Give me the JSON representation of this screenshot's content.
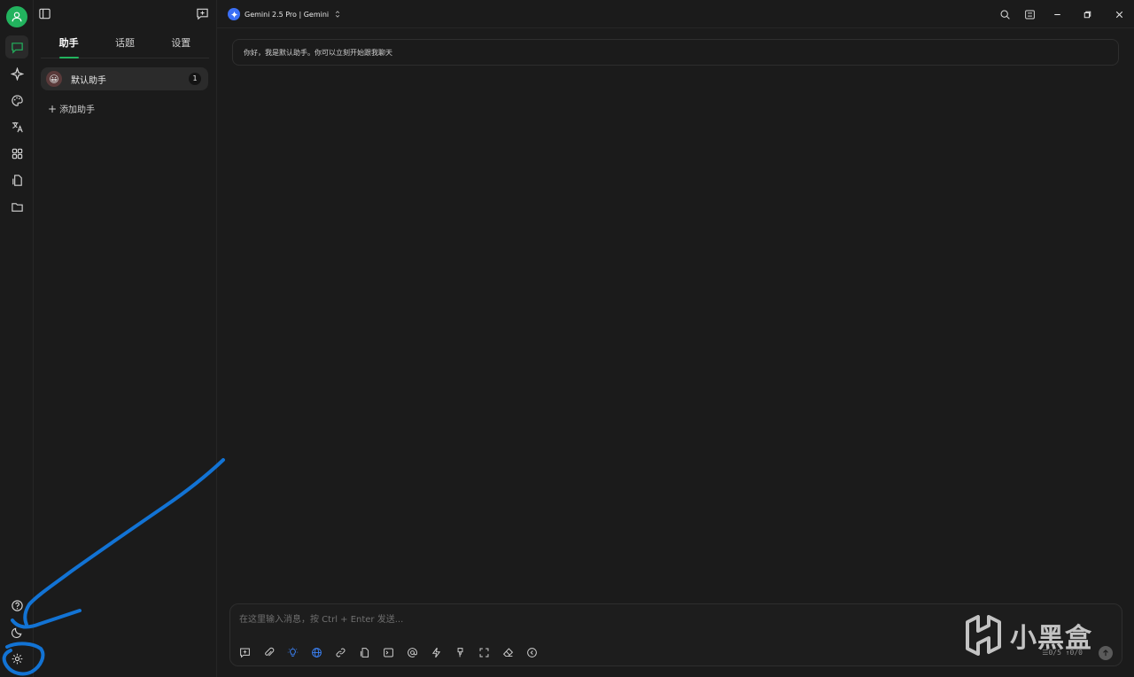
{
  "colors": {
    "accent": "#22b35e",
    "annotation": "#1273d4",
    "model_icon": "#3b6ff5"
  },
  "rail": {
    "items": [
      {
        "name": "chat-icon",
        "active": true
      },
      {
        "name": "sparkle-icon"
      },
      {
        "name": "palette-icon"
      },
      {
        "name": "translate-icon"
      },
      {
        "name": "apps-grid-icon"
      },
      {
        "name": "file-swap-icon"
      },
      {
        "name": "folder-icon"
      }
    ],
    "bottom": [
      {
        "name": "help-icon"
      },
      {
        "name": "moon-icon"
      },
      {
        "name": "settings-icon"
      }
    ]
  },
  "sidebar": {
    "tabs": [
      "助手",
      "话题",
      "设置"
    ],
    "active_tab": 0,
    "assistant": {
      "label": "默认助手",
      "count": "1",
      "emoji": "😀"
    },
    "add_label": "添加助手"
  },
  "topbar": {
    "model_label": "Gemini 2.5 Pro | Gemini"
  },
  "chat": {
    "greeting": "你好，我是默认助手。你可以立刻开始跟我聊天"
  },
  "composer": {
    "placeholder": "在这里输入消息，按 Ctrl + Enter 发送...",
    "counts": "☰0/5 ↑0/0",
    "tools": [
      "new-topic-icon",
      "attach-icon",
      "bulb-icon",
      "globe-icon",
      "link-icon",
      "file-icon",
      "terminal-icon",
      "at-icon",
      "bolt-icon",
      "brush-icon",
      "fullscreen-icon",
      "eraser-icon",
      "collapse-icon"
    ]
  },
  "watermark": {
    "text": "小黑盒"
  }
}
